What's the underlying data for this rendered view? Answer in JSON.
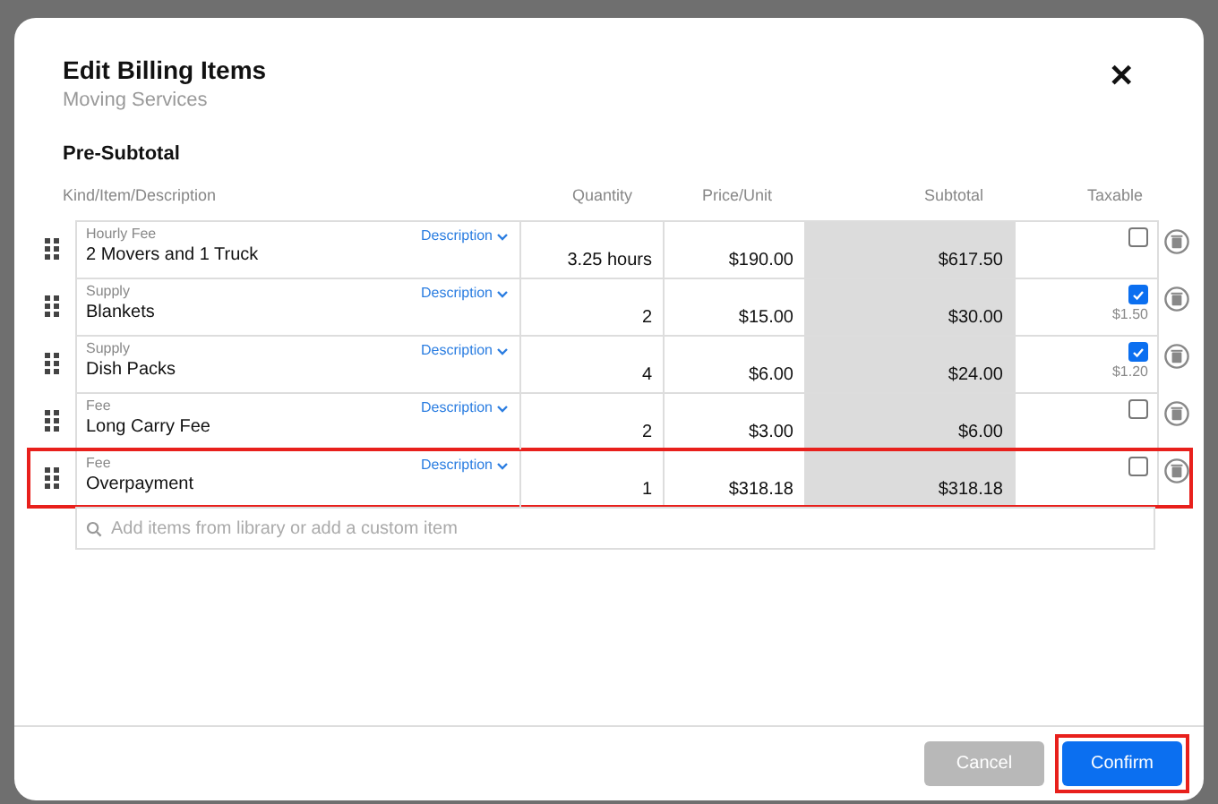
{
  "dialog": {
    "title": "Edit Billing Items",
    "subtitle": "Moving Services",
    "close_icon": "✕"
  },
  "section": {
    "title": "Pre-Subtotal"
  },
  "table": {
    "columns": [
      "Kind/Item/Description",
      "Quantity",
      "Price/Unit",
      "Subtotal",
      "Taxable"
    ],
    "rows": [
      {
        "kind": "Hourly Fee",
        "item": "2 Movers and 1 Truck",
        "description_link": "Description",
        "quantity": "3.25 hours",
        "price": "$190.00",
        "subtotal": "$617.50",
        "taxable": false,
        "highlighted": false
      },
      {
        "kind": "Supply",
        "item": "Blankets",
        "description_link": "Description",
        "quantity": "2",
        "price": "$15.00",
        "subtotal": "$30.00",
        "taxable": true,
        "tax": "$1.50",
        "highlighted": false
      },
      {
        "kind": "Supply",
        "item": "Dish Packs",
        "description_link": "Description",
        "quantity": "4",
        "price": "$6.00",
        "subtotal": "$24.00",
        "taxable": true,
        "tax": "$1.20",
        "highlighted": false
      },
      {
        "kind": "Fee",
        "item": "Long Carry Fee",
        "description_link": "Description",
        "quantity": "2",
        "price": "$3.00",
        "subtotal": "$6.00",
        "taxable": false,
        "highlighted": false
      },
      {
        "kind": "Fee",
        "item": "Overpayment",
        "description_link": "Description",
        "quantity": "1",
        "price": "$318.18",
        "subtotal": "$318.18",
        "taxable": false,
        "highlighted": true
      }
    ],
    "add_item": {
      "placeholder": "Add items from library or add a custom item"
    }
  },
  "footer": {
    "buttons": [
      {
        "label": "Cancel",
        "kind": "secondary",
        "disabled": true,
        "highlighted": false
      },
      {
        "label": "Confirm",
        "kind": "primary",
        "disabled": false,
        "highlighted": true
      }
    ]
  }
}
